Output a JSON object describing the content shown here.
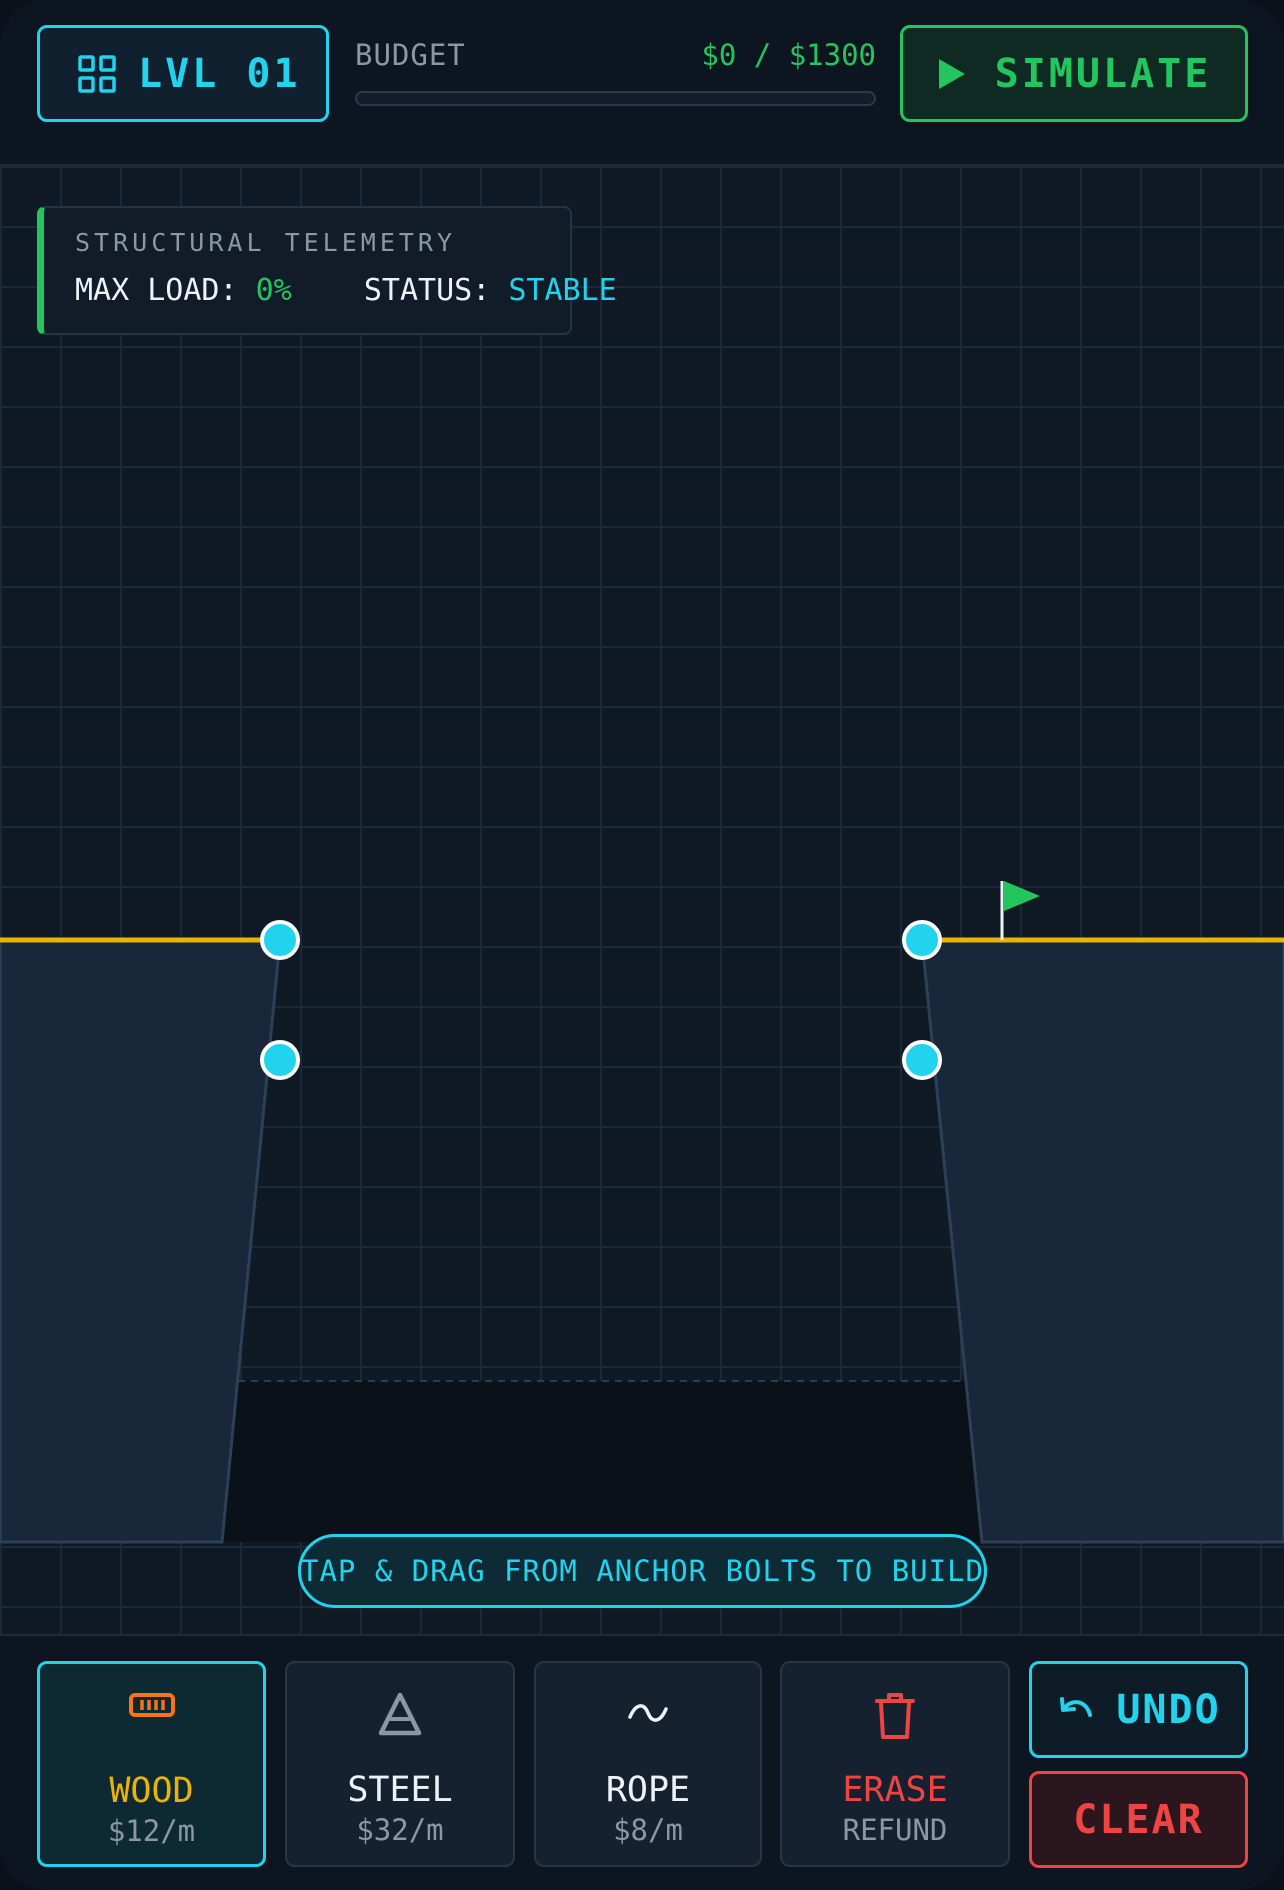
{
  "header": {
    "level_label": "LVL 01",
    "budget_label": "BUDGET",
    "budget_value": "$0 / $1300",
    "budget_used_fraction": 0,
    "simulate_label": "SIMULATE"
  },
  "telemetry": {
    "title": "STRUCTURAL TELEMETRY",
    "max_load_label": "MAX LOAD:",
    "max_load_value": "0%",
    "status_label": "STATUS:",
    "status_value": "STABLE"
  },
  "hint": "TAP & DRAG FROM ANCHOR BOLTS TO BUILD",
  "tools": [
    {
      "name": "WOOD",
      "sub": "$12/m",
      "icon": "wood-plank-icon",
      "selected": true
    },
    {
      "name": "STEEL",
      "sub": "$32/m",
      "icon": "steel-triangle-icon",
      "selected": false
    },
    {
      "name": "ROPE",
      "sub": "$8/m",
      "icon": "rope-wave-icon",
      "selected": false
    },
    {
      "name": "ERASE",
      "sub": "REFUND",
      "icon": "trash-icon",
      "selected": false
    }
  ],
  "actions": {
    "undo_label": "UNDO",
    "clear_label": "CLEAR"
  },
  "colors": {
    "accent_cyan": "#22d3ee",
    "accent_green": "#22c55e",
    "road_yellow": "#eab308",
    "danger_red": "#ef4444",
    "wood_orange": "#f97316",
    "terrain": "#18273a"
  }
}
